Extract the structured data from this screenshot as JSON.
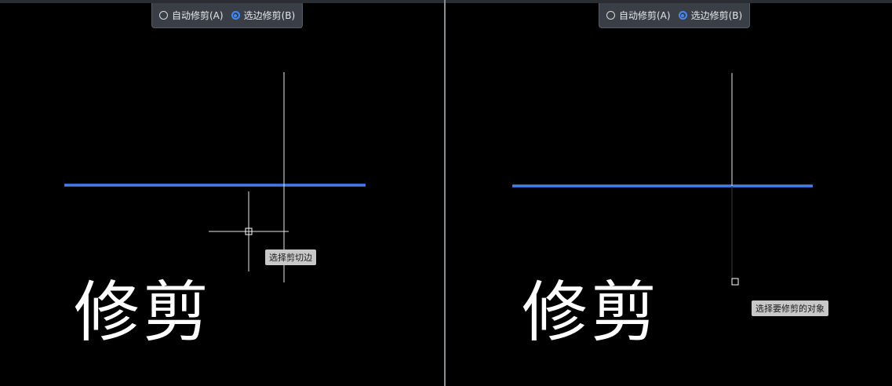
{
  "left_panel": {
    "mode_bar": {
      "options": [
        {
          "label": "自动修剪(A)",
          "selected": false
        },
        {
          "label": "选边修剪(B)",
          "selected": true
        }
      ]
    },
    "caption": "修剪",
    "tooltip": "选择剪切边"
  },
  "right_panel": {
    "mode_bar": {
      "options": [
        {
          "label": "自动修剪(A)",
          "selected": false
        },
        {
          "label": "选边修剪(B)",
          "selected": true
        }
      ]
    },
    "caption": "修剪",
    "tooltip": "选择要修剪的对象"
  },
  "colors": {
    "canvas": "#000000",
    "selected_line": "#2f63c8",
    "line_highlight": "#4e7fe0",
    "geometry": "#ffffff",
    "radio_selected": "#3d8bff",
    "mode_bar_bg": "#3a3f47",
    "tooltip_bg": "#c8c8c8"
  }
}
